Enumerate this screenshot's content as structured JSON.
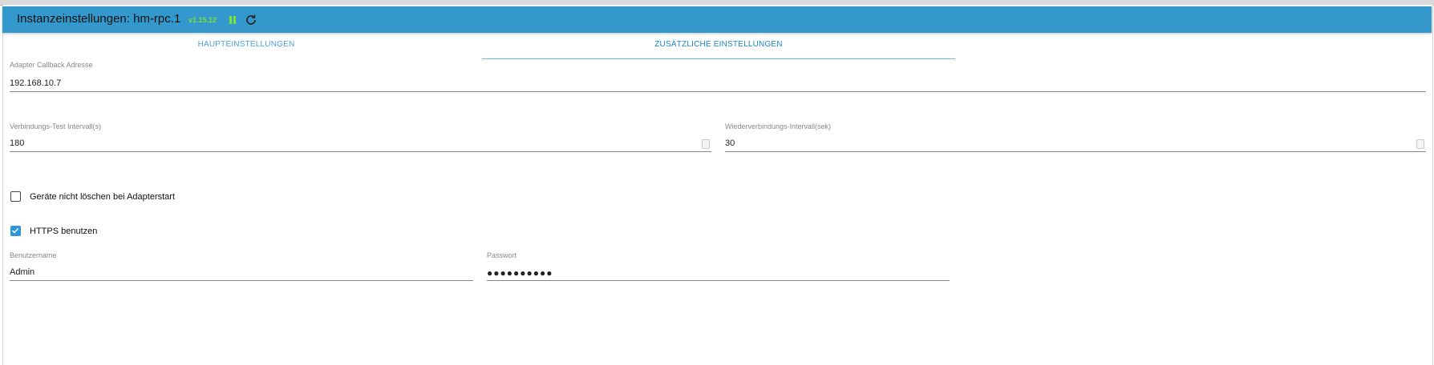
{
  "header": {
    "title": "Instanzeinstellungen: hm-rpc.1",
    "version": "v1.15.12"
  },
  "tabs": [
    {
      "label": "HAUPTEINSTELLUNGEN"
    },
    {
      "label": "ZUSÄTZLICHE EINSTELLUNGEN",
      "active": true
    }
  ],
  "fields": {
    "callback": {
      "label": "Adapter Callback Adresse",
      "value": "192.168.10.7"
    },
    "test_interval": {
      "label": "Verbindungs-Test Intervall(s)",
      "value": "180"
    },
    "reconnect_interval": {
      "label": "Wiederverbindungs-Intervall(sek)",
      "value": "30"
    },
    "username": {
      "label": "Benutzername",
      "value": "Admin"
    },
    "password": {
      "label": "Passwort",
      "value": "●●●●●●●●●●"
    }
  },
  "checkboxes": {
    "dont_delete": {
      "label": "Geräte nicht löschen bei Adapterstart",
      "checked": false
    },
    "use_https": {
      "label": "HTTPS benutzen",
      "checked": true
    }
  },
  "colors": {
    "header_bg": "#3399cc",
    "accent": "#2f97d8",
    "version_green": "#7ddf3a"
  },
  "icons": {
    "pause": "pause-icon",
    "reload": "reload-icon",
    "check": "check-icon",
    "spinner": "spinner-icon"
  }
}
